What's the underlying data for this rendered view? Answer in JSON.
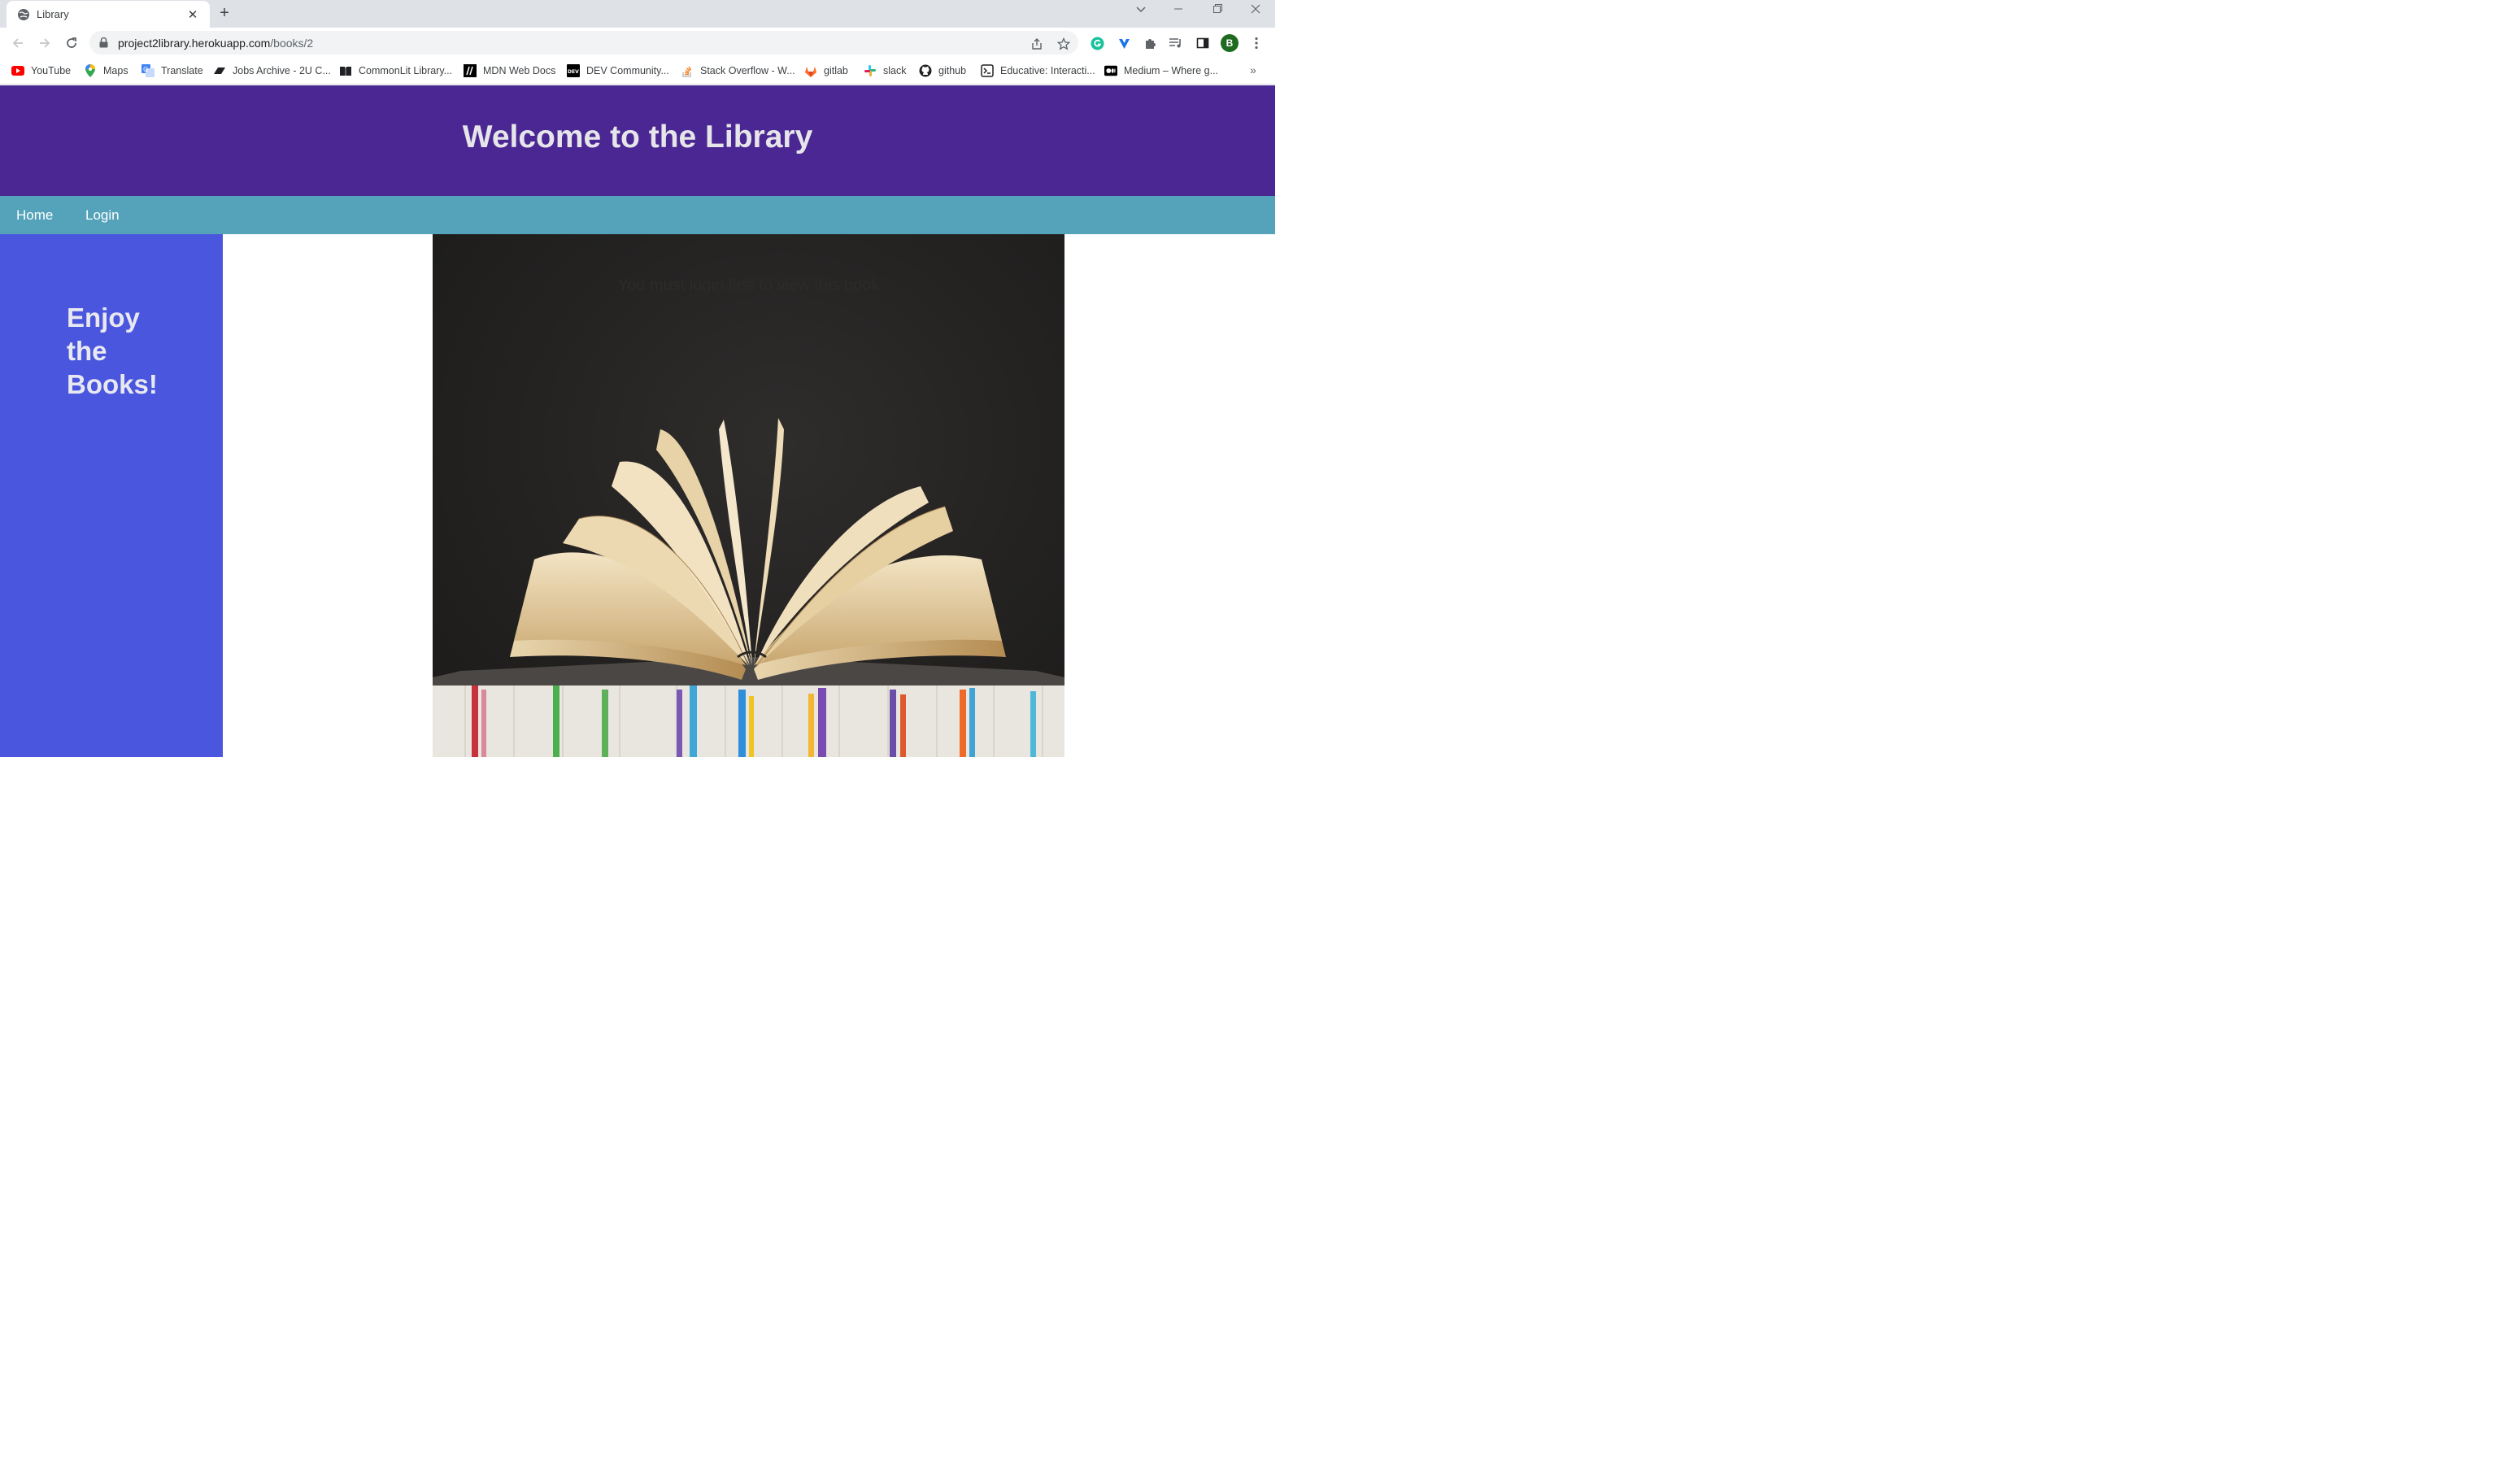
{
  "browser": {
    "tab_title": "Library",
    "url_host": "project2library.herokuapp.com",
    "url_path": "/books/2",
    "profile_initial": "B",
    "bookmarks": [
      {
        "label": "YouTube",
        "icon": "youtube-icon"
      },
      {
        "label": "Maps",
        "icon": "maps-icon"
      },
      {
        "label": "Translate",
        "icon": "translate-icon"
      },
      {
        "label": "Jobs Archive - 2U C...",
        "icon": "jobs-icon"
      },
      {
        "label": "CommonLit Library...",
        "icon": "book-icon"
      },
      {
        "label": "MDN Web Docs",
        "icon": "mdn-icon"
      },
      {
        "label": "DEV Community...",
        "icon": "dev-icon"
      },
      {
        "label": "Stack Overflow - W...",
        "icon": "stackoverflow-icon"
      },
      {
        "label": "gitlab",
        "icon": "gitlab-icon"
      },
      {
        "label": "slack",
        "icon": "slack-icon"
      },
      {
        "label": "github",
        "icon": "github-icon"
      },
      {
        "label": "Educative: Interacti...",
        "icon": "educative-icon"
      },
      {
        "label": "Medium – Where g...",
        "icon": "medium-icon"
      }
    ],
    "more_bookmarks": "»"
  },
  "page": {
    "title": "Welcome to the Library",
    "nav": {
      "home": "Home",
      "login": "Login"
    },
    "sidebar_line1": "Enjoy",
    "sidebar_line2": "the",
    "sidebar_line3": "Books!",
    "message": "You must login first to view this book"
  },
  "colors": {
    "header_bg": "#4b2793",
    "nav_bg": "#55a3bb",
    "sidebar_bg": "#4a56dd"
  }
}
